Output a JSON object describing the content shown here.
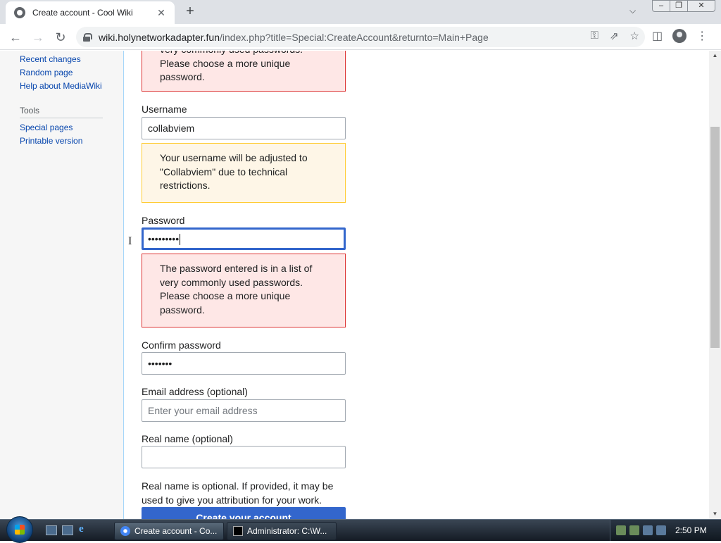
{
  "browser": {
    "tab_title": "Create account - Cool Wiki",
    "tab_close": "✕",
    "new_tab": "+",
    "url_host": "wiki.holynetworkadapter.fun",
    "url_path": "/index.php?title=Special:CreateAccount&returnto=Main+Page"
  },
  "sidebar": {
    "nav": [
      {
        "label": "Recent changes"
      },
      {
        "label": "Random page"
      },
      {
        "label": "Help about MediaWiki"
      }
    ],
    "tools_heading": "Tools",
    "tools": [
      {
        "label": "Special pages"
      },
      {
        "label": "Printable version"
      }
    ]
  },
  "form": {
    "top_error": {
      "line1": "very commonly used passwords.",
      "line2": "Please choose a more unique",
      "line3": "password."
    },
    "username": {
      "label": "Username",
      "value": "collabviem"
    },
    "username_warning": {
      "line1": "Your username will be adjusted to",
      "line2": "\"Collabviem\" due to technical",
      "line3": "restrictions."
    },
    "password": {
      "label": "Password",
      "value": "•••••••••"
    },
    "password_error": {
      "line1": "The password entered is in a list of",
      "line2": "very commonly used passwords.",
      "line3": "Please choose a more unique",
      "line4": "password."
    },
    "confirm_password": {
      "label": "Confirm password",
      "value": "•••••••"
    },
    "email": {
      "label": "Email address (optional)",
      "placeholder": "Enter your email address"
    },
    "real_name": {
      "label": "Real name (optional)",
      "value": ""
    },
    "real_name_help": {
      "line1": "Real name is optional. If provided, it may be",
      "line2": "used to give you attribution for your work."
    },
    "submit_label": "Create your account"
  },
  "taskbar": {
    "tasks": [
      {
        "label": "Create account - Co..."
      },
      {
        "label": "Administrator: C:\\W..."
      }
    ],
    "clock": "2:50 PM"
  }
}
